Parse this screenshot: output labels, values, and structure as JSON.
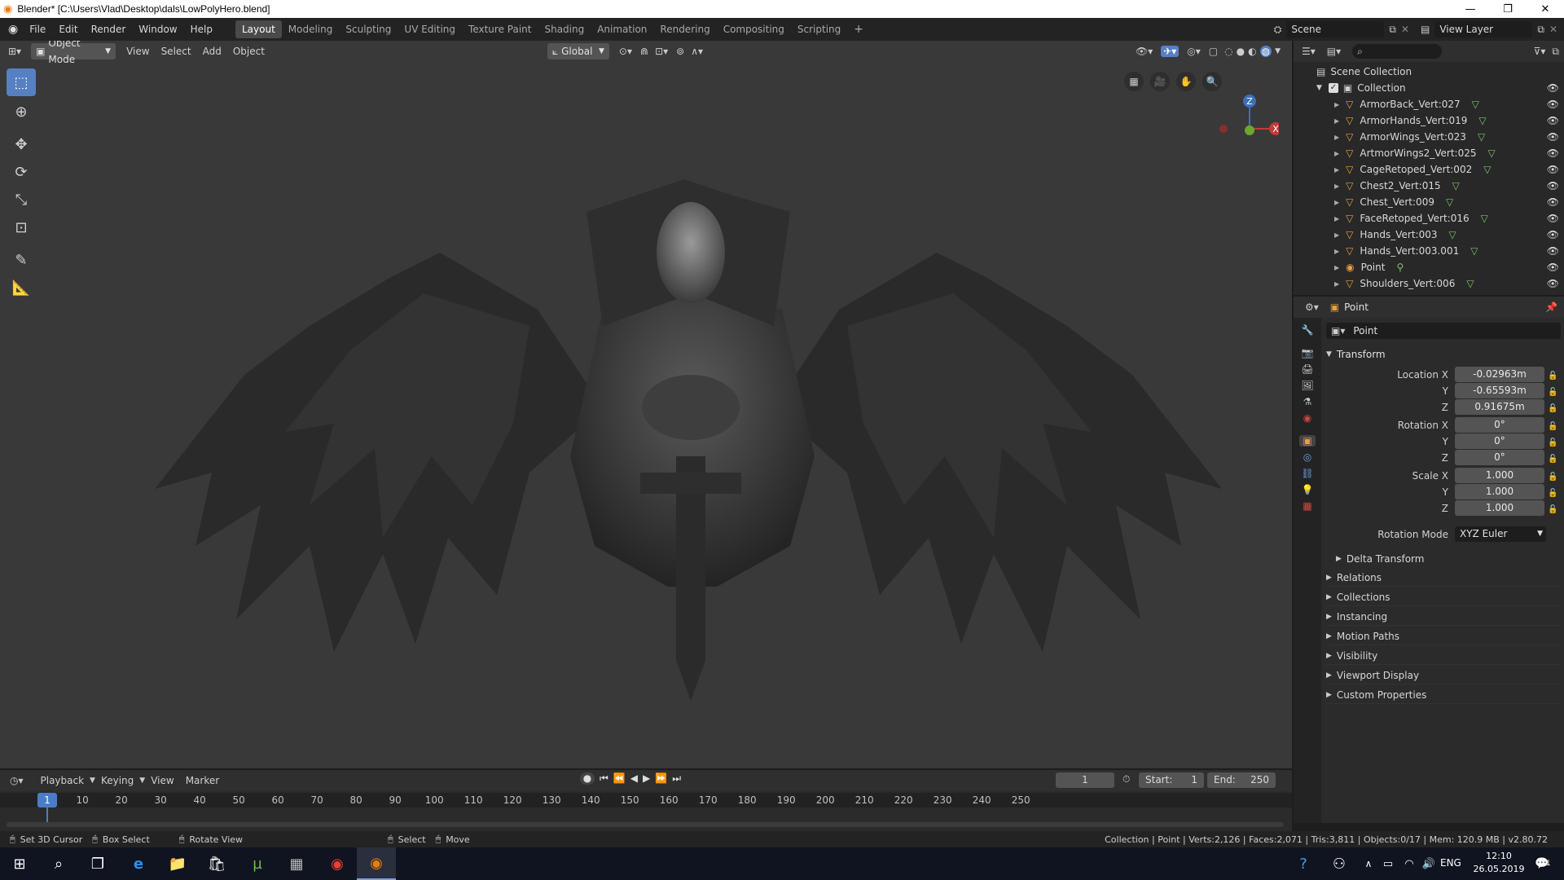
{
  "window": {
    "title": "Blender* [C:\\Users\\Vlad\\Desktop\\dals\\LowPolyHero.blend]"
  },
  "menu": [
    "File",
    "Edit",
    "Render",
    "Window",
    "Help"
  ],
  "workspaces": [
    "Layout",
    "Modeling",
    "Sculpting",
    "UV Editing",
    "Texture Paint",
    "Shading",
    "Animation",
    "Rendering",
    "Compositing",
    "Scripting"
  ],
  "scene": {
    "name": "Scene",
    "view_layer": "View Layer"
  },
  "viewport_header": {
    "mode": "Object Mode",
    "menus": [
      "View",
      "Select",
      "Add",
      "Object"
    ],
    "orientation": "Global"
  },
  "gizmo": {
    "x": "X",
    "y": "Y",
    "z": "Z"
  },
  "outliner": {
    "scene_collection": "Scene Collection",
    "collection": "Collection",
    "items": [
      {
        "name": "ArmorBack_Vert:027",
        "icon": "mesh-icon"
      },
      {
        "name": "ArmorHands_Vert:019",
        "icon": "mesh-icon"
      },
      {
        "name": "ArmorWings_Vert:023",
        "icon": "mesh-icon"
      },
      {
        "name": "ArtmorWings2_Vert:025",
        "icon": "mesh-icon"
      },
      {
        "name": "CageRetoped_Vert:002",
        "icon": "mesh-icon"
      },
      {
        "name": "Chest2_Vert:015",
        "icon": "mesh-icon"
      },
      {
        "name": "Chest_Vert:009",
        "icon": "mesh-icon"
      },
      {
        "name": "FaceRetoped_Vert:016",
        "icon": "mesh-icon"
      },
      {
        "name": "Hands_Vert:003",
        "icon": "mesh-icon"
      },
      {
        "name": "Hands_Vert:003.001",
        "icon": "mesh-icon"
      },
      {
        "name": "Point",
        "icon": "light-icon"
      },
      {
        "name": "Shoulders_Vert:006",
        "icon": "mesh-icon"
      }
    ]
  },
  "properties": {
    "object": "Point",
    "object_name_field": "Point",
    "transform": "Transform",
    "location_label": "Location X",
    "loc_x": "-0.02963m",
    "loc_y": "-0.65593m",
    "loc_z": "0.91675m",
    "rotation_label": "Rotation X",
    "rot_x": "0°",
    "rot_y": "0°",
    "rot_z": "0°",
    "scale_label": "Scale X",
    "scale_x": "1.000",
    "scale_y": "1.000",
    "scale_z": "1.000",
    "y": "Y",
    "z": "Z",
    "rotation_mode_label": "Rotation Mode",
    "rotation_mode": "XYZ Euler",
    "delta": "Delta Transform",
    "panels": [
      "Relations",
      "Collections",
      "Instancing",
      "Motion Paths",
      "Visibility",
      "Viewport Display",
      "Custom Properties"
    ]
  },
  "timeline": {
    "menus": [
      "Playback",
      "Keying",
      "View",
      "Marker"
    ],
    "current_frame": "1",
    "start_label": "Start:",
    "start": "1",
    "end_label": "End:",
    "end": "250",
    "ticks": [
      "10",
      "20",
      "30",
      "40",
      "50",
      "60",
      "70",
      "80",
      "90",
      "100",
      "110",
      "120",
      "130",
      "140",
      "150",
      "160",
      "170",
      "180",
      "190",
      "200",
      "210",
      "220",
      "230",
      "240",
      "250"
    ],
    "playhead": "1"
  },
  "statusbar": {
    "hints": [
      "Set 3D Cursor",
      "Box Select",
      "Rotate View",
      "Select",
      "Move"
    ],
    "info": "Collection | Point | Verts:2,126 | Faces:2,071 | Tris:3,811 | Objects:0/17 | Mem: 120.9 MB | v2.80.72"
  },
  "taskbar": {
    "lang": "ENG",
    "time": "12:10",
    "date": "26.05.2019",
    "notif": "1"
  }
}
